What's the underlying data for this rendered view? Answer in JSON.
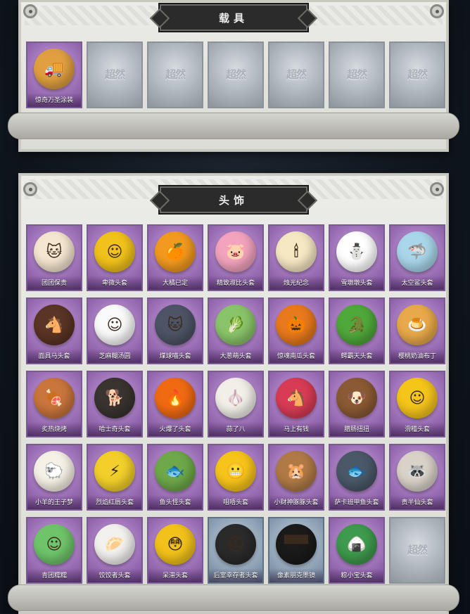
{
  "vehicles": {
    "title": "载具",
    "items": [
      {
        "label": "惊奇万圣涂装",
        "art": "🚚",
        "color": "#e0a040",
        "state": "owned"
      },
      {
        "label": "",
        "art": "超然",
        "state": "empty"
      },
      {
        "label": "",
        "art": "超然",
        "state": "empty"
      },
      {
        "label": "",
        "art": "超然",
        "state": "empty"
      },
      {
        "label": "",
        "art": "超然",
        "state": "empty"
      },
      {
        "label": "",
        "art": "超然",
        "state": "empty"
      },
      {
        "label": "",
        "art": "超然",
        "state": "empty"
      }
    ]
  },
  "headwear": {
    "title": "头饰",
    "items": [
      {
        "label": "团团保贵",
        "art": "🐱",
        "color": "#f4e6cf",
        "state": "owned"
      },
      {
        "label": "卑微头套",
        "art": "☺",
        "color": "#f1c21b",
        "state": "owned"
      },
      {
        "label": "大橘已定",
        "art": "🍊",
        "color": "#f29a1f",
        "state": "owned"
      },
      {
        "label": "精致淑比头套",
        "art": "🐷",
        "color": "#f3a3bd",
        "state": "owned"
      },
      {
        "label": "烛光纪念",
        "art": "🕯",
        "color": "#f7e8c4",
        "state": "owned"
      },
      {
        "label": "雪墩墩头套",
        "art": "⛄",
        "color": "#ffffff",
        "state": "owned"
      },
      {
        "label": "太空鲨头套",
        "art": "🦈",
        "color": "#a9d6ea",
        "state": "owned"
      },
      {
        "label": "面具马头套",
        "art": "🐴",
        "color": "#5a3424",
        "state": "owned"
      },
      {
        "label": "芝麻糊汤圆",
        "art": "☺",
        "color": "#fafafa",
        "state": "owned"
      },
      {
        "label": "煤球喵头套",
        "art": "🐱",
        "color": "#4e5466",
        "state": "owned"
      },
      {
        "label": "大葱萌头套",
        "art": "🥬",
        "color": "#8ac46a",
        "state": "owned"
      },
      {
        "label": "惊魂南瓜头套",
        "art": "🎃",
        "color": "#e8791c",
        "state": "owned"
      },
      {
        "label": "鳄霸天头套",
        "art": "🐊",
        "color": "#4fa83a",
        "state": "owned"
      },
      {
        "label": "樱桃奶油布丁",
        "art": "🍮",
        "color": "#e8a94a",
        "state": "owned"
      },
      {
        "label": "炙热烧烤",
        "art": "🍖",
        "color": "#c9753c",
        "state": "owned"
      },
      {
        "label": "哈士奇头套",
        "art": "🐕",
        "color": "#3a3430",
        "state": "owned"
      },
      {
        "label": "火爆了头套",
        "art": "🔥",
        "color": "#f06a12",
        "state": "owned"
      },
      {
        "label": "蒜了八",
        "art": "🧄",
        "color": "#f2efe8",
        "state": "owned"
      },
      {
        "label": "马上有钱",
        "art": "🐴",
        "color": "#d83c54",
        "state": "owned"
      },
      {
        "label": "腊肠扭扭",
        "art": "🐶",
        "color": "#8a5a34",
        "state": "owned"
      },
      {
        "label": "滑稽头套",
        "art": "☺",
        "color": "#f5c51a",
        "state": "owned"
      },
      {
        "label": "小羊的王子梦",
        "art": "🐑",
        "color": "#f6f1e6",
        "state": "owned"
      },
      {
        "label": "烈焰红唇头套",
        "art": "⚡",
        "color": "#f2cf2a",
        "state": "owned"
      },
      {
        "label": "鱼头怪头套",
        "art": "🐟",
        "color": "#6ea84a",
        "state": "owned"
      },
      {
        "label": "咀唔头套",
        "art": "😬",
        "color": "#f7c41a",
        "state": "owned"
      },
      {
        "label": "小财神豚豚头套",
        "art": "🐹",
        "color": "#b07a46",
        "state": "owned"
      },
      {
        "label": "萨卡班甲鱼头套",
        "art": "🐟",
        "color": "#4a5868",
        "state": "owned"
      },
      {
        "label": "贵半仙头套",
        "art": "🦝",
        "color": "#d9d2c9",
        "state": "owned"
      },
      {
        "label": "青团糯糯",
        "art": "☺",
        "color": "#6fc46a",
        "state": "owned"
      },
      {
        "label": "饺饺者头套",
        "art": "🥟",
        "color": "#f3f1ee",
        "state": "owned"
      },
      {
        "label": "呆滞头套",
        "art": "😳",
        "color": "#f2c21a",
        "state": "owned"
      },
      {
        "label": "后室幸存者头套",
        "art": "⛑",
        "color": "#2a2a2a",
        "state": "owned",
        "tone": "blue"
      },
      {
        "label": "像素朋克墨镜",
        "art": "▀▀",
        "color": "#1a1a1a",
        "state": "owned",
        "tone": "blue"
      },
      {
        "label": "粽小宝头套",
        "art": "🍙",
        "color": "#3e9a4c",
        "state": "owned"
      },
      {
        "label": "",
        "art": "超然",
        "state": "empty"
      }
    ]
  }
}
